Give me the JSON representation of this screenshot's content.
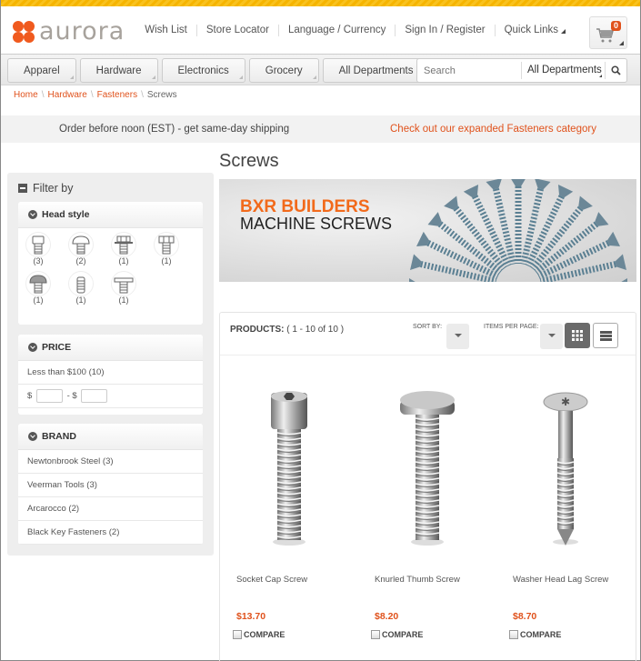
{
  "brand": {
    "name": "aurora",
    "accent": "#f05a1e",
    "topbar_color": "#f5b400"
  },
  "header": {
    "links": [
      "Wish List",
      "Store Locator",
      "Language / Currency",
      "Sign In / Register",
      "Quick Links"
    ],
    "cart": {
      "icon": "cart-icon",
      "count": "0"
    }
  },
  "nav": {
    "tabs": [
      "Apparel",
      "Hardware",
      "Electronics",
      "Grocery",
      "All Departments"
    ],
    "search": {
      "placeholder": "Search",
      "department": "All Departments",
      "icon": "search-icon"
    }
  },
  "breadcrumb": {
    "items": [
      "Home",
      "Hardware",
      "Fasteners"
    ],
    "current": "Screws"
  },
  "promo": {
    "left": "Order before noon (EST) - get same-day shipping",
    "right": "Check out our expanded Fasteners category"
  },
  "sidebar": {
    "title": "Filter by",
    "head_style": {
      "title": "Head style",
      "items": [
        {
          "icon": "socket-head-icon",
          "count": "(3)"
        },
        {
          "icon": "button-head-icon",
          "count": "(2)"
        },
        {
          "icon": "hex-washer-head-icon",
          "count": "(1)"
        },
        {
          "icon": "hex-head-icon",
          "count": "(1)"
        },
        {
          "icon": "knurled-head-icon",
          "count": "(1)"
        },
        {
          "icon": "set-screw-icon",
          "count": "(1)"
        },
        {
          "icon": "flat-washer-head-icon",
          "count": "(1)"
        }
      ]
    },
    "price": {
      "title": "PRICE",
      "option": "Less than $100 (10)",
      "min_prefix": "$",
      "max_prefix": "- $",
      "min_value": "",
      "max_value": ""
    },
    "brand": {
      "title": "BRAND",
      "items": [
        "Newtonbrook Steel (3)",
        "Veerman Tools (3)",
        "Arcarocco (2)",
        "Black Key Fasteners (2)"
      ]
    }
  },
  "main": {
    "title": "Screws",
    "banner": {
      "line1": "BXR BUILDERS",
      "line2": "MACHINE SCREWS"
    },
    "products_label": "PRODUCTS:",
    "products_range": "( 1 - 10 of 10 )",
    "sort_label": "SORT BY:",
    "items_per_page_label": "ITEMS PER PAGE:",
    "view": "grid",
    "products": [
      {
        "name": "Socket Cap Screw",
        "price": "$13.70",
        "compare": "COMPARE"
      },
      {
        "name": "Knurled Thumb Screw",
        "price": "$8.20",
        "compare": "COMPARE"
      },
      {
        "name": "Washer Head Lag Screw",
        "price": "$8.70",
        "compare": "COMPARE"
      }
    ]
  }
}
